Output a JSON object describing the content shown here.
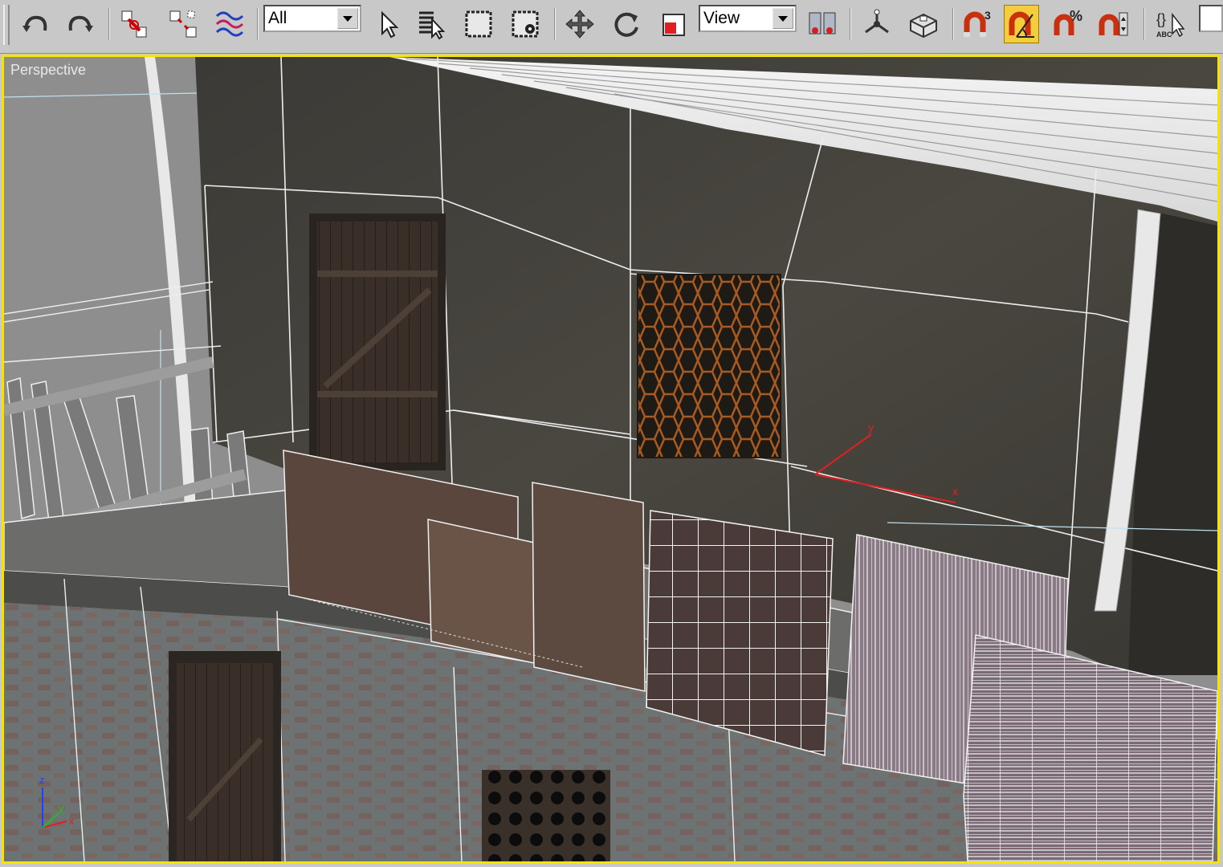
{
  "toolbar": {
    "selection_filter": "All",
    "reference_coord_system": "View",
    "buttons": [
      {
        "name": "undo-icon"
      },
      {
        "name": "redo-icon"
      },
      {
        "name": "select-and-link-icon"
      },
      {
        "name": "unlink-selection-icon"
      },
      {
        "name": "bind-to-space-warp-icon"
      },
      {
        "name": "select-object-icon"
      },
      {
        "name": "select-by-name-icon"
      },
      {
        "name": "rectangular-selection-region-icon"
      },
      {
        "name": "window-crossing-icon"
      },
      {
        "name": "select-and-move-icon"
      },
      {
        "name": "select-and-rotate-icon"
      },
      {
        "name": "select-and-scale-icon"
      },
      {
        "name": "use-pivot-point-center-icon"
      },
      {
        "name": "select-and-manipulate-icon"
      },
      {
        "name": "keyboard-shortcut-override-icon"
      },
      {
        "name": "snaps-toggle-icon"
      },
      {
        "name": "angle-snap-toggle-icon"
      },
      {
        "name": "percent-snap-toggle-icon"
      },
      {
        "name": "spinner-snap-toggle-icon"
      },
      {
        "name": "edit-named-selection-sets-icon"
      }
    ],
    "snaps_label": "3",
    "percent_label": "%",
    "named_sel_label": "ABC",
    "active_color": "#f5cd3c"
  },
  "viewport": {
    "label": "Perspective",
    "border_color": "#f4e400",
    "axis_labels": {
      "z": "z",
      "y": "y",
      "x": "x"
    },
    "axis_colors": {
      "x": "#e02020",
      "y": "#20c020",
      "z": "#2040ff"
    }
  }
}
